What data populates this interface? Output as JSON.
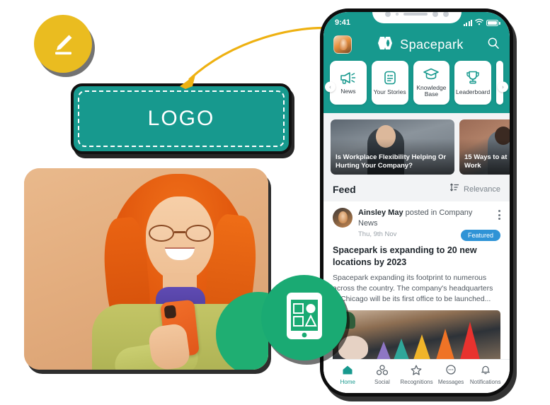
{
  "badges": {
    "pencil_icon": "pencil-edit-icon",
    "app_icon": "mobile-app-icon"
  },
  "logo_placeholder": {
    "label": "LOGO",
    "color": "#17998e",
    "border_style": "dashed"
  },
  "photo": {
    "alt": "smiling-woman-with-red-hair-using-orange-phone",
    "background_color": "#e3ad7e"
  },
  "arrow": {
    "name": "curved-pointer-arrow",
    "color": "#eeb111"
  },
  "phone": {
    "status_bar": {
      "time": "9:41",
      "signal_icon": "cellular-signal-icon",
      "wifi_icon": "wifi-icon",
      "battery_icon": "battery-full-icon"
    },
    "header": {
      "avatar": "user-avatar",
      "brand_name": "Spacepark",
      "brand_logo_icon": "spacepark-hexagon-logo",
      "search_icon": "search-icon",
      "accent_color": "#17998e"
    },
    "quick_tiles": {
      "prev_label": "‹",
      "next_label": "›",
      "items": [
        {
          "label": "News",
          "icon": "megaphone-icon"
        },
        {
          "label": "Your Stories",
          "icon": "document-icon"
        },
        {
          "label": "Knowledge Base",
          "icon": "graduation-cap-icon"
        },
        {
          "label": "Leaderboard",
          "icon": "trophy-icon"
        }
      ]
    },
    "stories": [
      {
        "title": "Is Workplace Flexibility Helping Or Hurting Your Company?"
      },
      {
        "title": "15 Ways to at Work"
      }
    ],
    "feed": {
      "title": "Feed",
      "sort_icon": "sort-icon",
      "sort_value": "Relevance"
    },
    "post": {
      "author": "Ainsley May",
      "action": " posted in Company News",
      "date": "Thu, 9th Nov",
      "badge": "Featured",
      "menu_icon": "kebab-menu-icon",
      "title": "Spacepark is expanding to 20 new locations by 2023",
      "body": "Spacepark expanding its footprint to numerous across the country. The company's headquarters in Chicago will be its first office to be launched...",
      "image_alt": "desk-with-colored-cones-and-hands"
    },
    "bottom_nav": [
      {
        "label": "Home",
        "icon": "home-icon",
        "active": true
      },
      {
        "label": "Social",
        "icon": "social-icon",
        "active": false
      },
      {
        "label": "Recognitions",
        "icon": "star-icon",
        "active": false
      },
      {
        "label": "Messages",
        "icon": "message-icon",
        "active": false
      },
      {
        "label": "Notifications",
        "icon": "bell-icon",
        "active": false
      }
    ]
  }
}
